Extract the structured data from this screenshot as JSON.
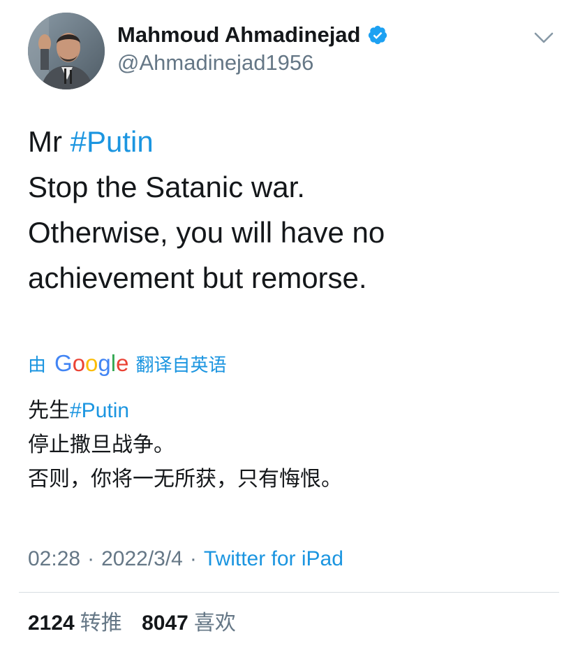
{
  "author": {
    "display_name": "Mahmoud Ahmadinejad",
    "handle": "@Ahmadinejad1956",
    "verified": true
  },
  "icons": {
    "verified": "verified-badge-icon",
    "menu": "chevron-down-icon"
  },
  "tweet": {
    "lines": [
      {
        "prefix": "Mr ",
        "hashtag": "#Putin"
      },
      {
        "text": "Stop the Satanic war."
      },
      {
        "text": "Otherwise, you will have no"
      },
      {
        "text": "achievement but remorse."
      }
    ]
  },
  "translation": {
    "by_label": "由",
    "provider": "Google",
    "from_label": "翻译自英语",
    "lines": [
      {
        "prefix": "先生",
        "hashtag": "#Putin"
      },
      {
        "text": "停止撒旦战争。"
      },
      {
        "text": "否则，你将一无所获，只有悔恨。"
      }
    ]
  },
  "meta": {
    "time": "02:28",
    "separator": "·",
    "date": "2022/3/4",
    "source": "Twitter for iPad"
  },
  "stats": {
    "retweets_count": "2124",
    "retweets_label": "转推",
    "likes_count": "8047",
    "likes_label": "喜欢"
  },
  "colors": {
    "link": "#1b95e0",
    "secondary_text": "#657786",
    "primary_text": "#14171a",
    "google_blue": "#4285F4",
    "google_red": "#EA4335",
    "google_yellow": "#FBBC05",
    "google_green": "#34A853"
  }
}
